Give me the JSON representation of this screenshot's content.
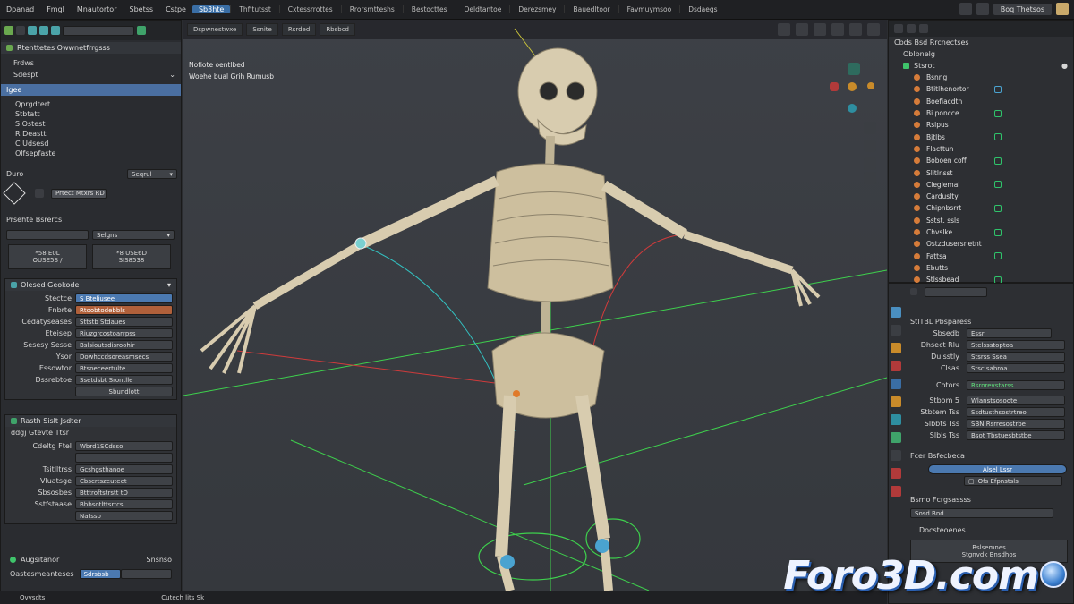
{
  "menubar": {
    "items": [
      "Dpanad",
      "Fmgl",
      "Mnautortor",
      "Sbetss",
      "Cstpe"
    ],
    "active": "Sb3hte",
    "tabs": [
      "Thfitutsst",
      "Cxtessrrottes",
      "Rrorsmtteshs",
      "Bestocttes",
      "Oeldtantoe",
      "Derezsmey",
      "Bauedltoor",
      "Favmuymsoo",
      "Dsdaegs"
    ],
    "scene": "Boq Thetsos"
  },
  "left": {
    "header": "Rtenttetes Owwnetfrrgsss",
    "items": [
      "Frdws",
      "Sdespt"
    ],
    "selected": "Igee",
    "tree": [
      "Qprgdtert",
      "Stbtatt",
      "S Ostest",
      "R Deastt",
      "C Udsesd",
      "Olfsepfaste"
    ],
    "mode_label": "Duro",
    "mode_value": "Seqrul",
    "tool_button": "Prtect Mtxrs RD",
    "props_title": "Prsehte Bsrercs",
    "props_dropdown": "Selgns",
    "box1": [
      "*58 E0L",
      "OUSE5S /"
    ],
    "box2": [
      "*8 USE6D",
      "SIS8538"
    ],
    "section2_title": "Olesed Geokode",
    "section2_rows": [
      {
        "label": "Stectce",
        "value": "S Bteliusee"
      },
      {
        "label": "Fnbrte",
        "value": "Rtoobtodebbls"
      },
      {
        "label": "Cedatyseases",
        "value": "Sttstb Stdaues"
      },
      {
        "label": "Eteisep",
        "value": "Riuzgrcostoarrpss"
      },
      {
        "label": "Sesesy Sesse",
        "value": "Bslsioutsdisroohir"
      },
      {
        "label": "Ysor",
        "value": "Dowhccdsoreasmsecs"
      },
      {
        "label": "Essowtor",
        "value": "Btsoeceertulte"
      },
      {
        "label": "Dssrebtoe",
        "value": "Ssetdsbt Srontlle"
      }
    ],
    "section2_button": "Sbundlott",
    "section3_title": "Rasth Sislt Jsdter",
    "section3_sub": "ddgj Gtevte Ttsr",
    "section3_rows": [
      {
        "label": "Cdeltg Ftel",
        "value": "Wbrd1SCdsso"
      },
      {
        "label": "",
        "value": ""
      },
      {
        "label": "Tsitlltrss",
        "value": "Gcshgsthanoe"
      },
      {
        "label": "Vluatsge",
        "value": "Cbscrtszeuteet"
      },
      {
        "label": "Sbsosbes",
        "value": "Btttroftstrstt tD"
      },
      {
        "label": "Sstfstaase",
        "value": "Bbbsotlttsrtcsl"
      }
    ],
    "section3_button": "Natsso",
    "footer_left": "Augsitanor",
    "footer_right": "Snsnso",
    "footer_field_label": "Oastesmeanteses",
    "footer_field_value": "Sdrsbsb"
  },
  "viewport": {
    "toolbar": [
      "Dspwnestwxe",
      "Ssnite",
      "Rsrded",
      "Rbsbcd"
    ],
    "info_line1": "Nofiote oentlbed",
    "info_line2": "Woehe bual Grih Rumusb"
  },
  "outliner": {
    "header": "Cbds Bsd Rrcnectses",
    "sub1": "Oblbnelg",
    "sub2": "Stsrot",
    "items": [
      "Bsnng",
      "Btitlhenortor",
      "Boefiacdtn",
      "Bi poncce",
      "Rslpus",
      "Bjtlbs",
      "Flacttun",
      "Boboen coff",
      "Slitlnsst",
      "Cleglemal",
      "Carduslty",
      "Chipnbsrrt",
      "Sstst. ssls",
      "Chvslke",
      "Ostzdusersnetnt",
      "Fattsa",
      "Ebutts",
      "Stlssbead"
    ]
  },
  "properties": {
    "title": "StlTBL Pbsparess",
    "rows": [
      {
        "label": "Sbsedb",
        "value": "Essr"
      },
      {
        "label": "Dhsect Rlu",
        "value": "Stelssstoptoa"
      },
      {
        "label": "Dulsstly",
        "value": "Stsrss Ssea"
      },
      {
        "label": "Clsas",
        "value": "Stsc sabroa"
      }
    ],
    "colors_label": "Cotors",
    "colors_value": "Rsrorevstarss",
    "rows2": [
      {
        "label": "Stbom 5",
        "value": "Wlanstsosoote"
      },
      {
        "label": "Stbtem Tss",
        "value": "Ssdtusthsostrtreo"
      },
      {
        "label": "Slbbts Tss",
        "value": "SBN Rsrresostrbe"
      },
      {
        "label": "Slbls Tss",
        "value": "Bsot Tbstuesbtstbe"
      }
    ],
    "section_title": "Fcer Bsfecbeca",
    "blue_button": "Alsel Lssr",
    "toggle_label": "Ofs Efpnstsls",
    "subsection": "Bsmo Fcrgsassss",
    "sub_field": "Sosd Bnd",
    "sub_item": "Docsteoenes",
    "card_line1": "Bslsemnes",
    "card_line2": "Stgnvdk Bnsdhos"
  },
  "status": {
    "left": "Ovvsdts",
    "mid": "Cutech lits Sk"
  },
  "watermark": "Foro3D.com",
  "colors": {
    "accent": "#4a6fa1",
    "x_axis": "#d03b3b",
    "y_axis": "#3ed14d",
    "bone": "#d8ccaf"
  }
}
